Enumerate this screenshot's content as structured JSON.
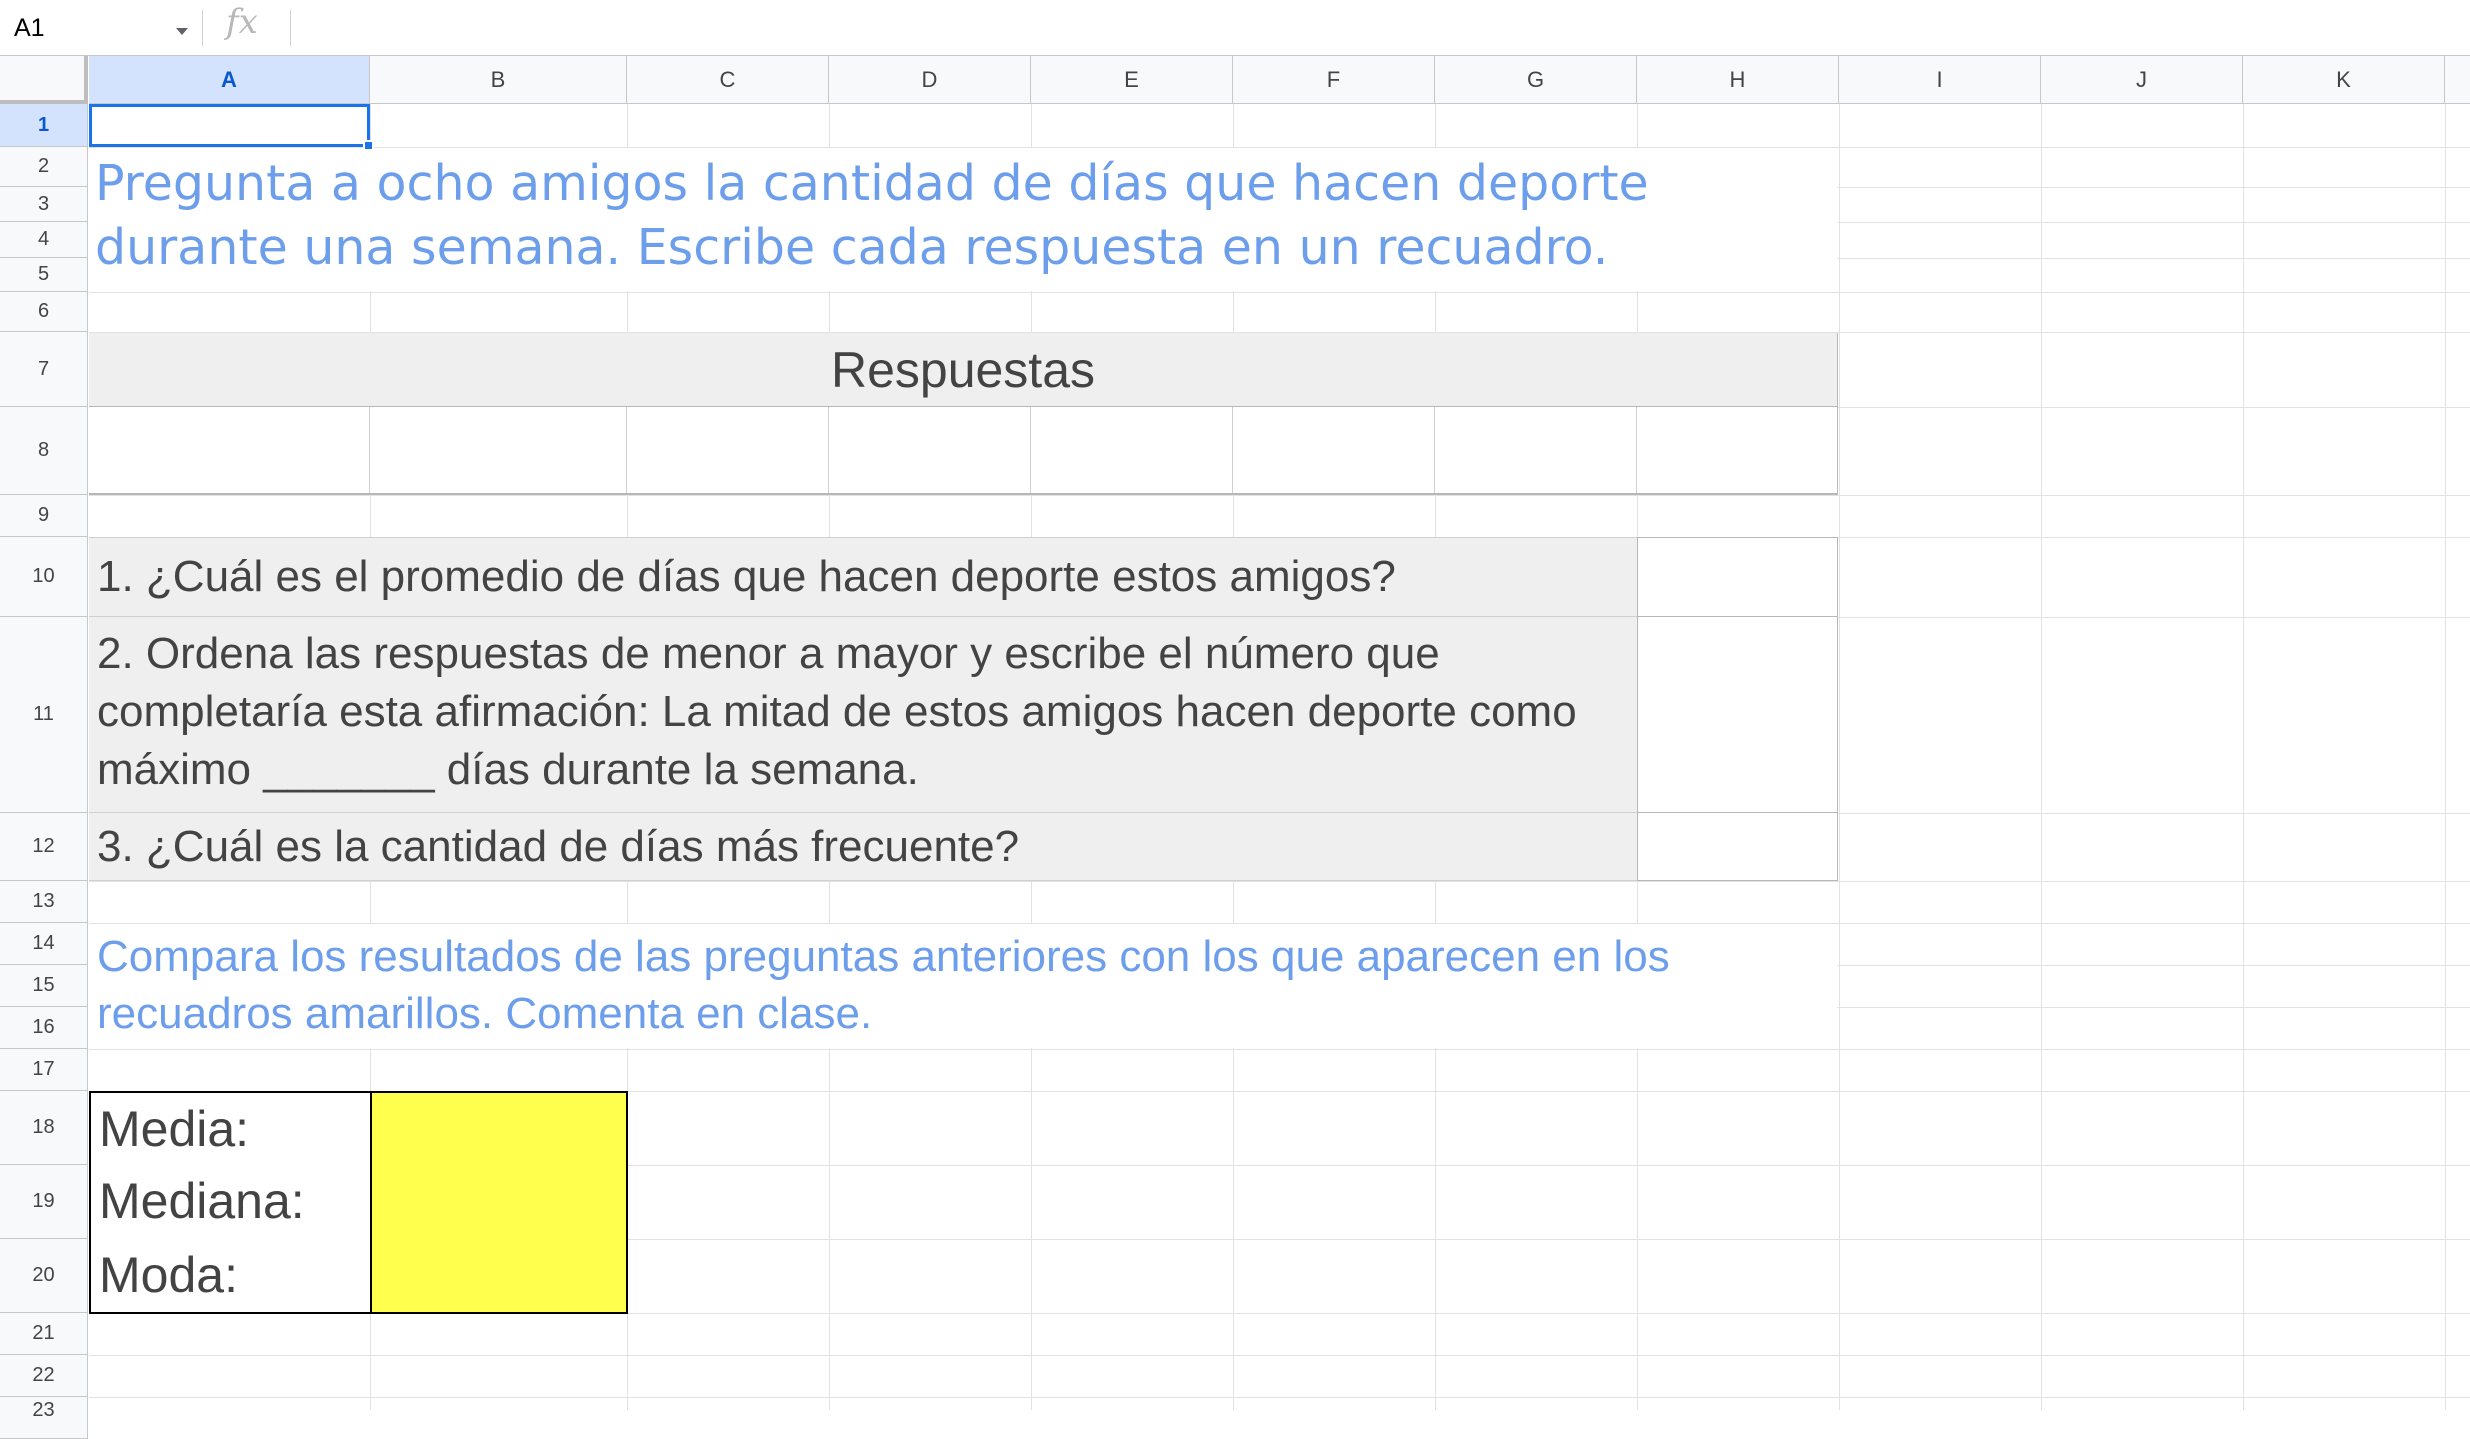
{
  "formula_bar": {
    "cell_ref": "A1",
    "fx_label": "fx",
    "formula": ""
  },
  "columns": [
    "A",
    "B",
    "C",
    "D",
    "E",
    "F",
    "G",
    "H",
    "I",
    "J",
    "K"
  ],
  "rows": [
    "1",
    "2",
    "3",
    "4",
    "5",
    "6",
    "7",
    "8",
    "9",
    "10",
    "11",
    "12",
    "13",
    "14",
    "15",
    "16",
    "17",
    "18",
    "19",
    "20",
    "21",
    "22",
    "23"
  ],
  "sheet": {
    "instruction_1": "Pregunta a ocho amigos la cantidad de días que hacen deporte durante una semana. Escribe cada respuesta en un recuadro.",
    "responses_header": "Respuestas",
    "question_1": "1. ¿Cuál es el promedio de días que hacen deporte estos amigos?",
    "question_2": "2. Ordena las respuestas de menor a mayor y escribe el número que completaría esta afirmación: La mitad de estos amigos hacen deporte como máximo _______ días durante la semana.",
    "question_3": "3. ¿Cuál es la cantidad de días más frecuente?",
    "instruction_2": "Compara los resultados de las preguntas anteriores con los que aparecen en los recuadros amarillos. Comenta en clase.",
    "stats": [
      {
        "label": "Media:",
        "value": ""
      },
      {
        "label": "Mediana:",
        "value": ""
      },
      {
        "label": "Moda:",
        "value": ""
      }
    ]
  },
  "colors": {
    "instruction_text": "#6d9eeb",
    "question_fill": "#efefef",
    "highlight_fill": "#ffff4d",
    "selection": "#1a73e8"
  }
}
